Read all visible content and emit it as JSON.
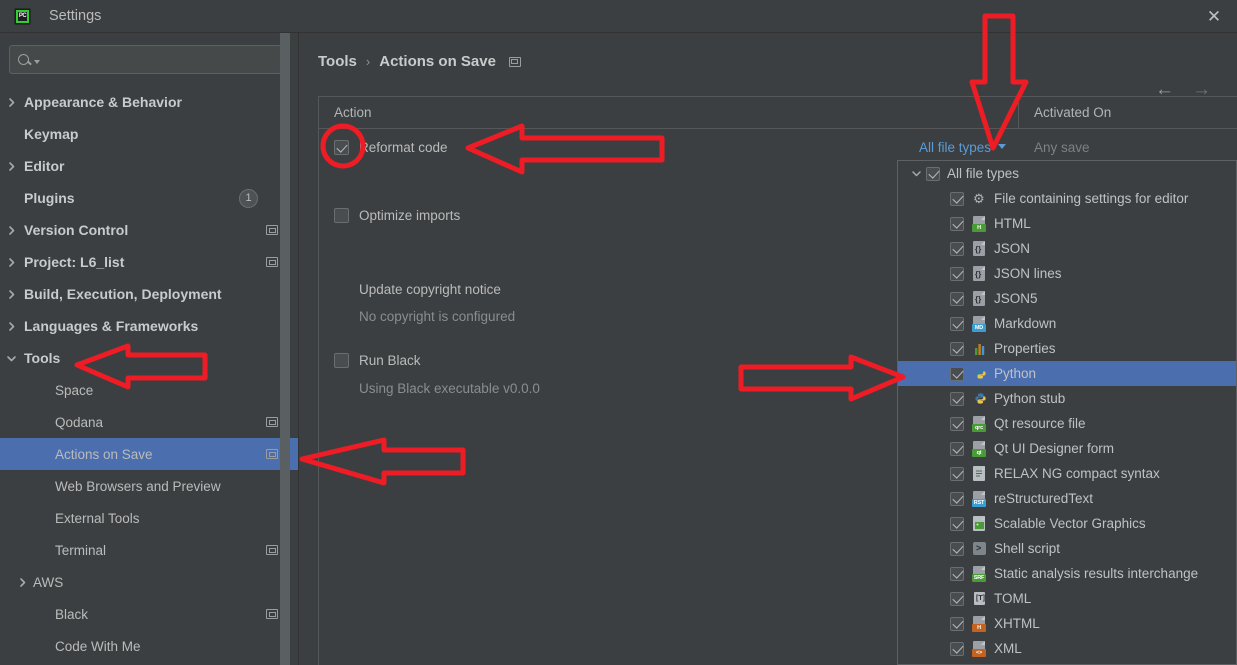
{
  "window": {
    "title": "Settings",
    "app_icon": "pycharm-icon",
    "close_label": "✕"
  },
  "sidebar": {
    "search": {
      "value": "",
      "placeholder": ""
    },
    "items": [
      {
        "label": "Appearance & Behavior",
        "level": 0,
        "expandable": true,
        "expanded": false,
        "bold": true
      },
      {
        "label": "Keymap",
        "level": 0,
        "expandable": false,
        "bold": true
      },
      {
        "label": "Editor",
        "level": 0,
        "expandable": true,
        "expanded": false,
        "bold": true
      },
      {
        "label": "Plugins",
        "level": 0,
        "expandable": false,
        "bold": true,
        "badge": "1"
      },
      {
        "label": "Version Control",
        "level": 0,
        "expandable": true,
        "expanded": false,
        "bold": true,
        "indicator": true
      },
      {
        "label": "Project: L6_list",
        "level": 0,
        "expandable": true,
        "expanded": false,
        "bold": true,
        "indicator": true
      },
      {
        "label": "Build, Execution, Deployment",
        "level": 0,
        "expandable": true,
        "expanded": false,
        "bold": true
      },
      {
        "label": "Languages & Frameworks",
        "level": 0,
        "expandable": true,
        "expanded": false,
        "bold": true
      },
      {
        "label": "Tools",
        "level": 0,
        "expandable": true,
        "expanded": true,
        "bold": true
      },
      {
        "label": "Space",
        "level": 1,
        "expandable": false
      },
      {
        "label": "Qodana",
        "level": 1,
        "expandable": false,
        "indicator": true
      },
      {
        "label": "Actions on Save",
        "level": 1,
        "expandable": false,
        "selected": true,
        "indicator": true
      },
      {
        "label": "Web Browsers and Preview",
        "level": 1,
        "expandable": false
      },
      {
        "label": "External Tools",
        "level": 1,
        "expandable": false
      },
      {
        "label": "Terminal",
        "level": 1,
        "expandable": false,
        "indicator": true
      },
      {
        "label": "AWS",
        "level": 1,
        "expandable": true,
        "expanded": false
      },
      {
        "label": "Black",
        "level": 1,
        "expandable": false,
        "indicator": true
      },
      {
        "label": "Code With Me",
        "level": 1,
        "expandable": false
      }
    ]
  },
  "content": {
    "breadcrumb": {
      "parent": "Tools",
      "separator": "›",
      "current": "Actions on Save"
    },
    "nav": {
      "back": "←",
      "forward": "→"
    },
    "table": {
      "columns": [
        "Action",
        "Activated On"
      ],
      "rows": [
        {
          "action": "Reformat code",
          "checked": true,
          "scope_link": "All file types",
          "activated_on": "Any save",
          "has_dropdown": true
        },
        {
          "action": "Optimize imports",
          "checked": false
        },
        {
          "action": "Update copyright notice",
          "checked": null,
          "note": "No copyright is configured"
        },
        {
          "action": "Run Black",
          "checked": false,
          "note": "Using Black executable v0.0.0"
        }
      ]
    }
  },
  "popup": {
    "items": [
      {
        "label": "All file types",
        "level": 0,
        "checked": true,
        "expanded": true,
        "icon": "none"
      },
      {
        "label": "File containing settings for editor",
        "level": 1,
        "checked": true,
        "icon": "gear-icon"
      },
      {
        "label": "HTML",
        "level": 1,
        "checked": true,
        "icon": "html-file-icon",
        "tag": "H",
        "tag_color": "#4a9b37"
      },
      {
        "label": "JSON",
        "level": 1,
        "checked": true,
        "icon": "json-file-icon"
      },
      {
        "label": "JSON lines",
        "level": 1,
        "checked": true,
        "icon": "json-file-icon"
      },
      {
        "label": "JSON5",
        "level": 1,
        "checked": true,
        "icon": "json-file-icon"
      },
      {
        "label": "Markdown",
        "level": 1,
        "checked": true,
        "icon": "markdown-file-icon",
        "tag": "MD",
        "tag_color": "#3c9dd0"
      },
      {
        "label": "Properties",
        "level": 1,
        "checked": true,
        "icon": "properties-file-icon"
      },
      {
        "label": "Python",
        "level": 1,
        "checked": true,
        "icon": "python-file-icon",
        "selected": true
      },
      {
        "label": "Python stub",
        "level": 1,
        "checked": true,
        "icon": "python-file-icon"
      },
      {
        "label": "Qt resource file",
        "level": 1,
        "checked": true,
        "icon": "qrc-file-icon",
        "tag": "qrc",
        "tag_color": "#4a9b37"
      },
      {
        "label": "Qt UI Designer form",
        "level": 1,
        "checked": true,
        "icon": "qt-file-icon",
        "tag": "qt",
        "tag_color": "#4a9b37"
      },
      {
        "label": "RELAX NG compact syntax",
        "level": 1,
        "checked": true,
        "icon": "text-file-icon"
      },
      {
        "label": "reStructuredText",
        "level": 1,
        "checked": true,
        "icon": "rst-file-icon",
        "tag": "RST",
        "tag_color": "#3c9dd0"
      },
      {
        "label": "Scalable Vector Graphics",
        "level": 1,
        "checked": true,
        "icon": "svg-file-icon"
      },
      {
        "label": "Shell script",
        "level": 1,
        "checked": true,
        "icon": "shell-file-icon"
      },
      {
        "label": "Static analysis results interchange",
        "level": 1,
        "checked": true,
        "icon": "sarif-file-icon",
        "tag": "SRF",
        "tag_color": "#4a9b37"
      },
      {
        "label": "TOML",
        "level": 1,
        "checked": true,
        "icon": "toml-file-icon"
      },
      {
        "label": "XHTML",
        "level": 1,
        "checked": true,
        "icon": "xhtml-file-icon",
        "tag": "H",
        "tag_color": "#c4621f"
      },
      {
        "label": "XML",
        "level": 1,
        "checked": true,
        "icon": "xml-file-icon",
        "tag": "<>",
        "tag_color": "#c4621f"
      }
    ]
  },
  "annotations": {
    "color": "#ee1c25",
    "shapes": [
      {
        "name": "circle-reformat-checkbox"
      },
      {
        "name": "arrow-left-to-reformat-code"
      },
      {
        "name": "arrow-left-to-tools"
      },
      {
        "name": "arrow-left-to-actions-on-save"
      },
      {
        "name": "arrow-down-to-all-file-types-dropdown"
      },
      {
        "name": "arrow-right-to-python"
      }
    ]
  },
  "colors": {
    "background": "#3c3f41",
    "selection": "#4b6eaf",
    "text": "#bbbbbb",
    "link": "#5b9bd5",
    "annotation": "#ee1c25"
  }
}
